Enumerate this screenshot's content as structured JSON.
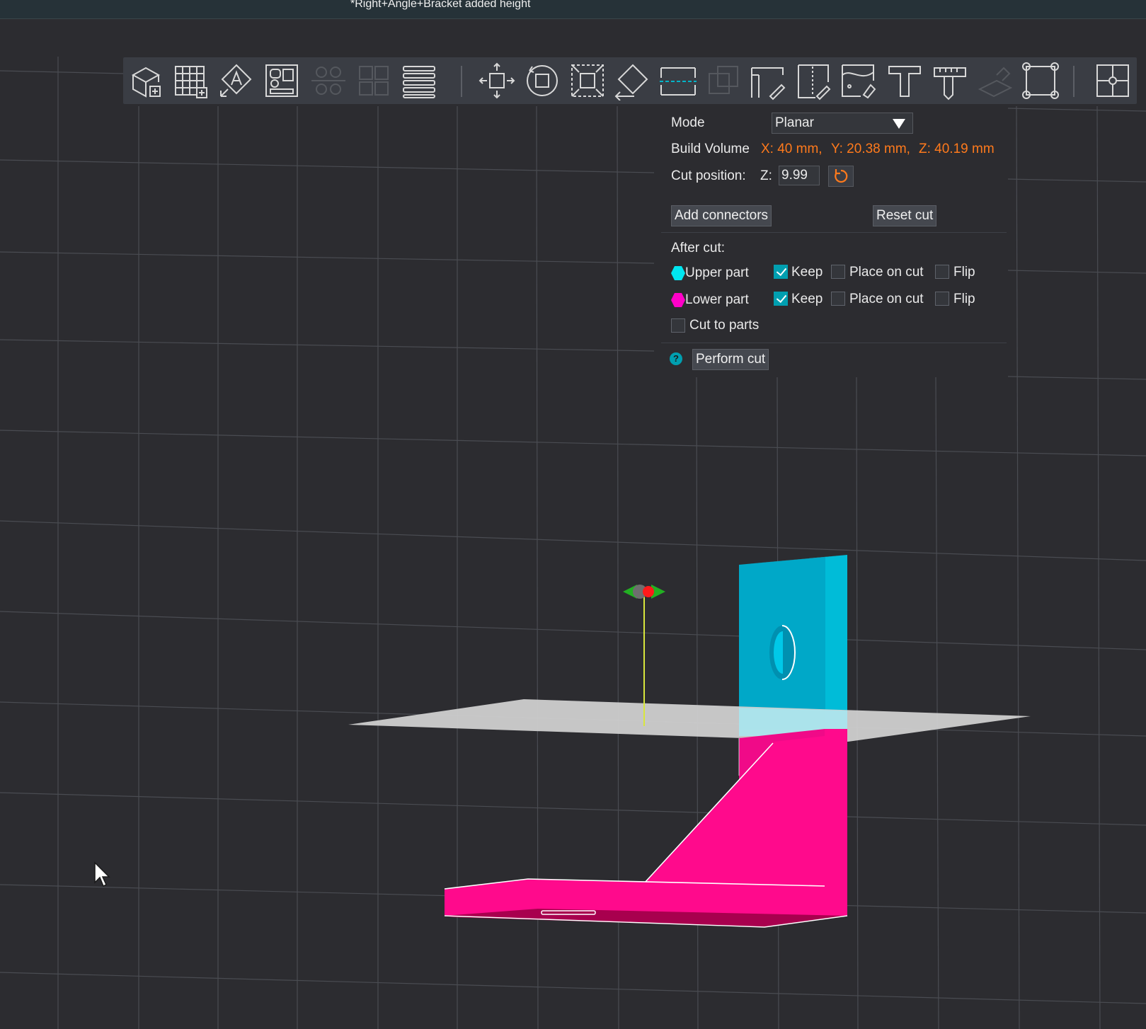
{
  "window": {
    "title": "*Right+Angle+Bracket added height"
  },
  "toolbar": {
    "buttons": [
      {
        "icon": "add-cube-icon"
      },
      {
        "icon": "add-plate-icon"
      },
      {
        "icon": "auto-orient-icon"
      },
      {
        "icon": "arrange-icon"
      },
      {
        "icon": "split-objects-icon"
      },
      {
        "icon": "split-parts-icon"
      },
      {
        "icon": "layers-icon"
      },
      {
        "icon": "move-icon"
      },
      {
        "icon": "rotate-icon"
      },
      {
        "icon": "scale-icon"
      },
      {
        "icon": "lay-on-face-icon"
      },
      {
        "icon": "cut-icon"
      },
      {
        "icon": "mesh-boolean-icon"
      },
      {
        "icon": "support-paint-icon"
      },
      {
        "icon": "seam-paint-icon"
      },
      {
        "icon": "color-paint-icon"
      },
      {
        "icon": "text-icon"
      },
      {
        "icon": "measure-icon"
      },
      {
        "icon": "assembly-icon"
      },
      {
        "icon": "fit-view-icon"
      },
      {
        "icon": "assembly-view-icon"
      }
    ]
  },
  "cut_panel": {
    "mode_label": "Mode",
    "mode_value": "Planar",
    "build_volume_label": "Build Volume",
    "build_volume_x": "X: 40 mm,",
    "build_volume_y": "Y: 20.38 mm,",
    "build_volume_z": "Z: 40.19 mm",
    "cut_position_label": "Cut position:",
    "z_label": "Z:",
    "z_value": "9.99",
    "add_connectors": "Add connectors",
    "reset_cut": "Reset cut",
    "after_cut_label": "After cut:",
    "upper_part": {
      "label": "Upper part",
      "keep": "Keep",
      "keep_checked": true,
      "place_on_cut": "Place on cut",
      "place_checked": false,
      "flip": "Flip",
      "flip_checked": false,
      "color": "#00e6f0"
    },
    "lower_part": {
      "label": "Lower part",
      "keep": "Keep",
      "keep_checked": true,
      "place_on_cut": "Place on cut",
      "place_checked": false,
      "flip": "Flip",
      "flip_checked": false,
      "color": "#ff00c8"
    },
    "cut_to_parts": "Cut to parts",
    "cut_to_parts_checked": false,
    "help": "?",
    "perform_cut": "Perform cut"
  },
  "scene": {
    "upper_part_color": "#00b4d4",
    "lower_part_color": "#ff0a8c",
    "cut_plane_color": "#cfcfcf"
  }
}
